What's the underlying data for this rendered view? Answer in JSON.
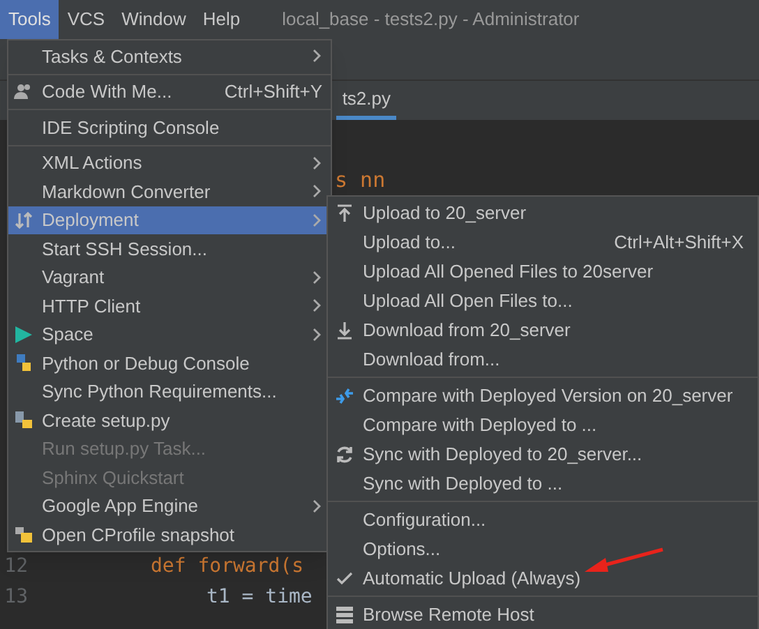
{
  "menubar": {
    "items": [
      {
        "label": "Tools",
        "selected": true
      },
      {
        "label": "VCS",
        "selected": false
      },
      {
        "label": "Window",
        "selected": false
      },
      {
        "label": "Help",
        "selected": false
      }
    ],
    "title": "local_base - tests2.py - Administrator"
  },
  "editor": {
    "tab": "ts2.py",
    "lines": [
      {
        "text": "s nn"
      },
      {
        "number": "12",
        "text": "def forward(s"
      },
      {
        "number": "13",
        "text": "t1 = time"
      }
    ]
  },
  "tools_menu": {
    "groups": [
      [
        {
          "label": "Tasks & Contexts",
          "submenu": true,
          "disabled": false,
          "selected": false
        }
      ],
      [
        {
          "label": "Code With Me...",
          "shortcut": "Ctrl+Shift+Y",
          "submenu": false,
          "disabled": false,
          "selected": false
        }
      ],
      [
        {
          "label": "IDE Scripting Console",
          "submenu": false,
          "disabled": false,
          "selected": false
        }
      ],
      [
        {
          "label": "XML Actions",
          "submenu": true,
          "disabled": false,
          "selected": false
        },
        {
          "label": "Markdown Converter",
          "submenu": true,
          "disabled": false,
          "selected": false
        },
        {
          "label": "Deployment",
          "submenu": true,
          "disabled": false,
          "selected": true
        },
        {
          "label": "Start SSH Session...",
          "submenu": false,
          "disabled": false,
          "selected": false
        },
        {
          "label": "Vagrant",
          "submenu": true,
          "disabled": false,
          "selected": false
        },
        {
          "label": "HTTP Client",
          "submenu": true,
          "disabled": false,
          "selected": false
        },
        {
          "label": "Space",
          "submenu": true,
          "disabled": false,
          "selected": false
        },
        {
          "label": "Python or Debug Console",
          "submenu": false,
          "disabled": false,
          "selected": false
        },
        {
          "label": "Sync Python Requirements...",
          "submenu": false,
          "disabled": false,
          "selected": false
        },
        {
          "label": "Create setup.py",
          "submenu": false,
          "disabled": false,
          "selected": false
        },
        {
          "label": "Run setup.py Task...",
          "submenu": false,
          "disabled": true,
          "selected": false
        },
        {
          "label": "Sphinx Quickstart",
          "submenu": false,
          "disabled": true,
          "selected": false
        },
        {
          "label": "Google App Engine",
          "submenu": true,
          "disabled": false,
          "selected": false
        },
        {
          "label": "Open CProfile snapshot",
          "submenu": false,
          "disabled": false,
          "selected": false
        }
      ]
    ]
  },
  "deployment_menu": {
    "groups": [
      [
        {
          "label": "Upload to 20_server",
          "checked": false
        },
        {
          "label": "Upload to...",
          "shortcut": "Ctrl+Alt+Shift+X",
          "checked": false
        },
        {
          "label": "Upload All Opened Files to 20server",
          "checked": false
        },
        {
          "label": "Upload All Open Files to...",
          "checked": false
        },
        {
          "label": "Download from 20_server",
          "checked": false
        },
        {
          "label": "Download from...",
          "checked": false
        }
      ],
      [
        {
          "label": "Compare with Deployed Version on 20_server",
          "checked": false
        },
        {
          "label": "Compare with Deployed to ...",
          "checked": false
        },
        {
          "label": "Sync with Deployed to 20_server...",
          "checked": false
        },
        {
          "label": "Sync with Deployed to ...",
          "checked": false
        }
      ],
      [
        {
          "label": "Configuration...",
          "checked": false
        },
        {
          "label": "Options...",
          "checked": false
        },
        {
          "label": "Automatic Upload (Always)",
          "checked": true
        }
      ],
      [
        {
          "label": "Browse Remote Host",
          "checked": false
        }
      ]
    ]
  }
}
